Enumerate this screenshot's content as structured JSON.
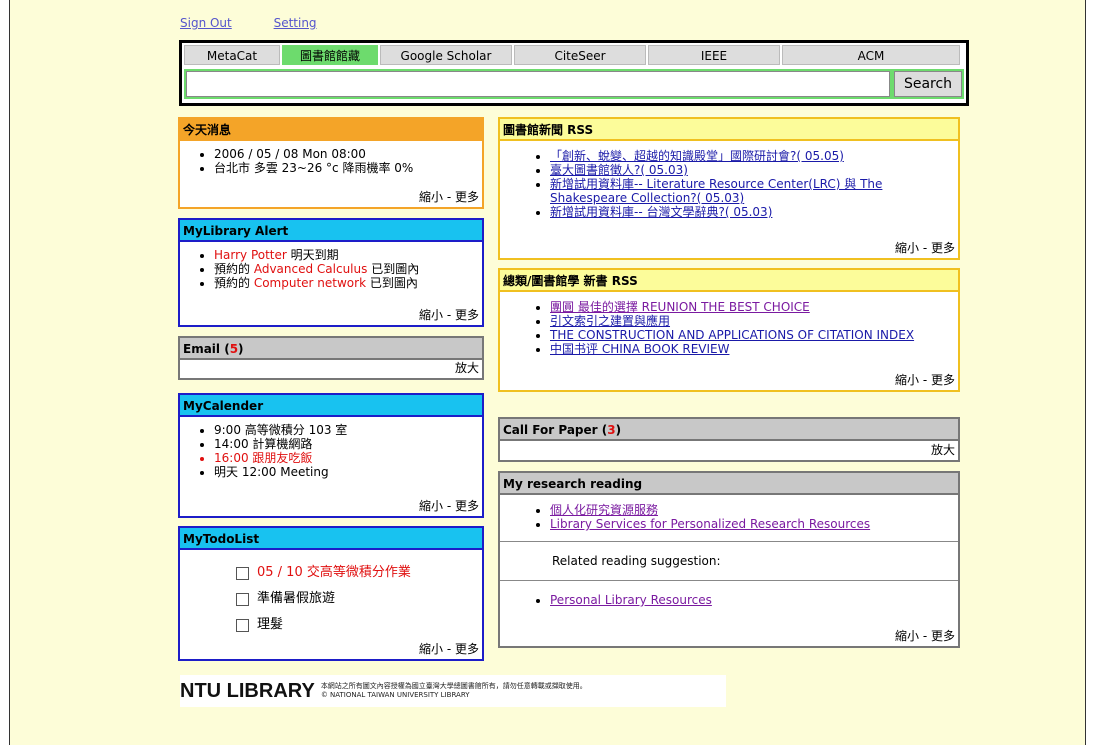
{
  "topnav": {
    "sign_out": "Sign Out",
    "setting": "Setting"
  },
  "search": {
    "tabs": [
      "MetaCat",
      "圖書館館藏",
      "Google Scholar",
      "CiteSeer",
      "IEEE",
      "ACM"
    ],
    "active_tab": "圖書館館藏",
    "input_value": "",
    "button_label": "Search"
  },
  "news": {
    "title": "今天消息",
    "items": [
      "2006 / 05 / 08 Mon 08:00",
      "台北市 多雲 23~26 °c 降雨機率 0%"
    ],
    "footer": "縮小 - 更多"
  },
  "alert": {
    "title": "MyLibrary Alert",
    "items": [
      {
        "red": "Harry Potter",
        "suffix": " 明天到期",
        "prefix": ""
      },
      {
        "prefix": "預約的 ",
        "red": "Advanced Calculus",
        "suffix": " 已到圖內"
      },
      {
        "prefix": "預約的 ",
        "red": "Computer network",
        "suffix": " 已到圖內"
      }
    ],
    "footer": "縮小 - 更多"
  },
  "email": {
    "title": "Email (",
    "count": "5",
    "close": ")",
    "footer": "放大"
  },
  "calendar": {
    "title": "MyCalender",
    "items": [
      "9:00 高等微積分 103 室",
      "14:00 計算機網路",
      "16:00 跟朋友吃飯",
      "明天 12:00 Meeting"
    ],
    "footer": "縮小 - 更多"
  },
  "todo": {
    "title": "MyTodoList",
    "items": [
      "05 / 10 交高等微積分作業",
      "準備暑假旅遊",
      "理髮"
    ],
    "footer": "縮小 - 更多"
  },
  "libnews": {
    "title": "圖書館新聞 RSS",
    "items": [
      "「創新、蛻變、超越的知識殿堂」國際研討會?( 05.05)",
      "臺大圖書館徵人?( 05.03)",
      "新增試用資料庫-- Literature Resource Center(LRC) 與 The Shakespeare Collection?( 05.03)",
      "新增試用資料庫-- 台灣文學辭典?( 05.03)"
    ],
    "footer": "縮小 - 更多"
  },
  "newbooks": {
    "title": "總類/圖書館學 新書 RSS",
    "items": [
      "團圓 最佳的選擇 REUNION THE BEST CHOICE",
      "引文索引之建置與應用",
      "THE CONSTRUCTION AND APPLICATIONS OF CITATION INDEX",
      "中国书评 CHINA BOOK REVIEW"
    ],
    "footer": "縮小 - 更多"
  },
  "cfp": {
    "title": "Call For Paper (",
    "count": "3",
    "close": ")",
    "footer": "放大"
  },
  "research": {
    "title": "My research reading",
    "items": [
      "個人化研究資源服務",
      "Library Services for Personalized Research Resources"
    ],
    "related_label": "Related reading suggestion:",
    "related_items": [
      "Personal Library Resources"
    ],
    "footer": "縮小 - 更多"
  },
  "footer": {
    "brand": "NTU LIBRARY",
    "copy_line1": "本網站之所有圖文內容授權為國立臺灣大學總圖書館所有，請勿任意轉載或擷取使用。",
    "copy_line2": "© NATIONAL TAIWAN UNIVERSITY LIBRARY"
  },
  "colors": {
    "page_bg": "#fdfdd8",
    "tab_active": "#6ddb6d",
    "blue_header": "#18c2f0",
    "orange": "#f4a428",
    "gold_header": "#fcfc9a",
    "gray_header": "#c8c8c8",
    "alert_red": "#e01010"
  }
}
